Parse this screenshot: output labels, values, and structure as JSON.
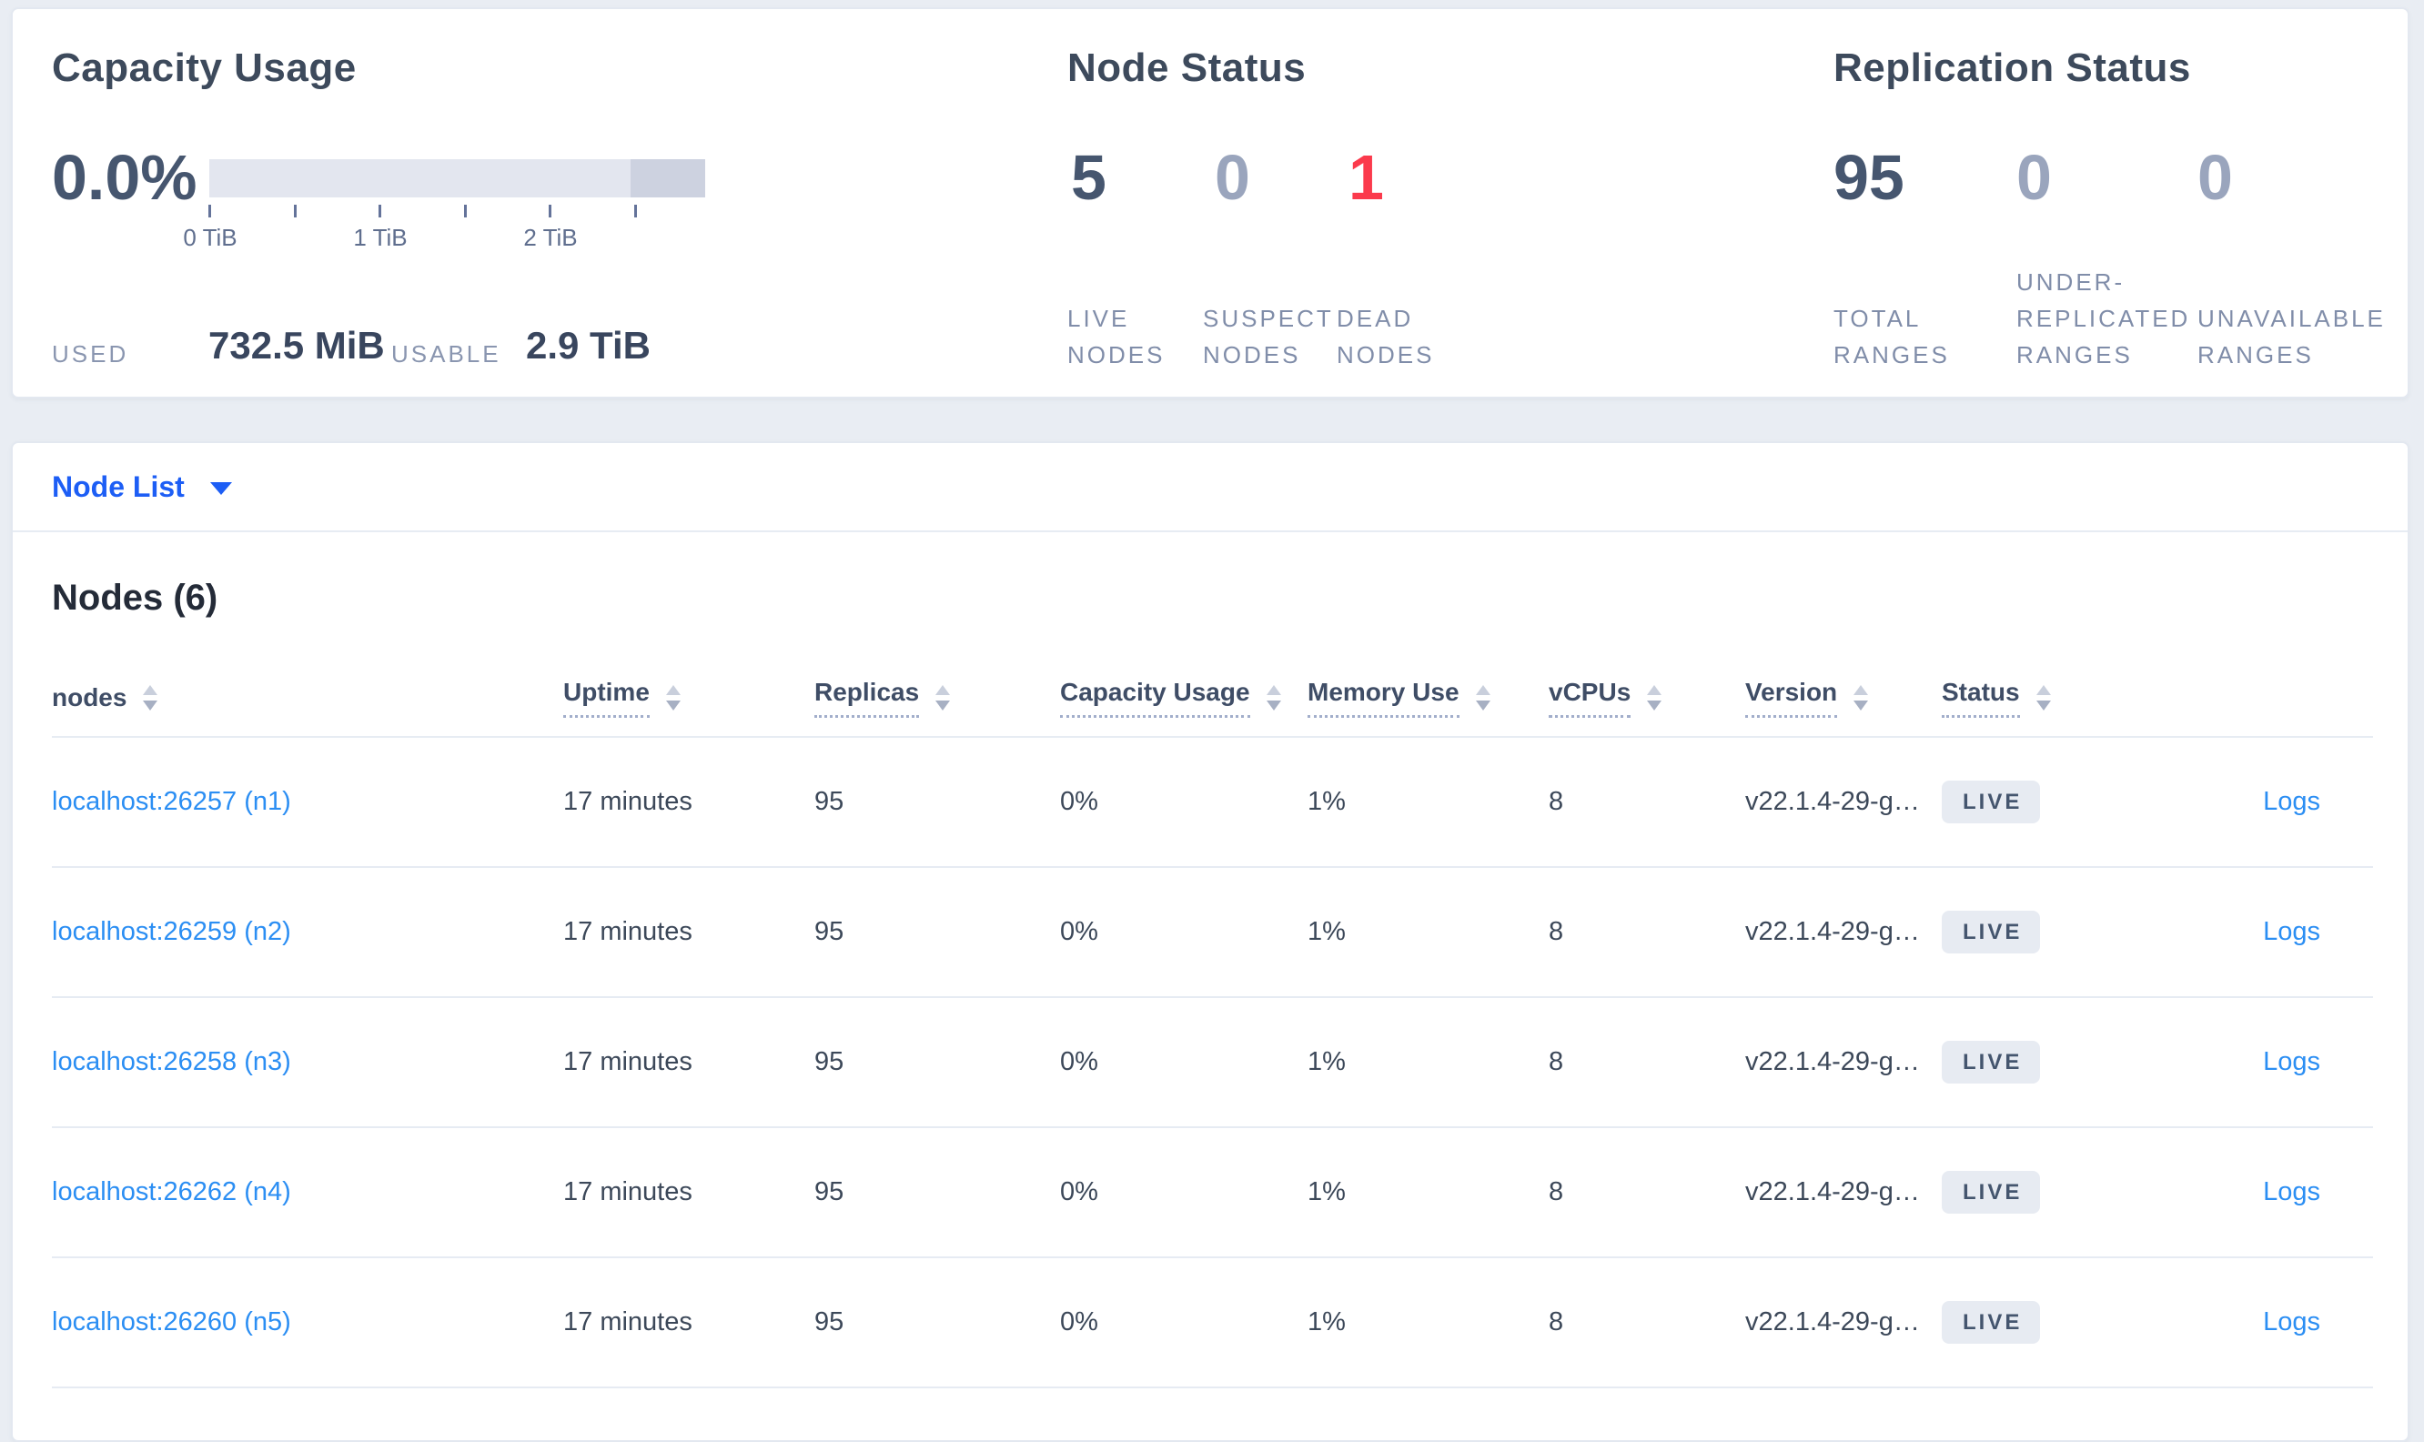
{
  "overview": {
    "capacity": {
      "title": "Capacity Usage",
      "percent": "0.0%",
      "tick_labels": [
        "0 TiB",
        "1 TiB",
        "2 TiB"
      ],
      "used_label": "USED",
      "used_value": "732.5 MiB",
      "usable_label": "USABLE",
      "usable_value": "2.9 TiB"
    },
    "node_status": {
      "title": "Node Status",
      "stats": [
        {
          "value": "5",
          "label": "LIVE NODES"
        },
        {
          "value": "0",
          "label": "SUSPECT NODES"
        },
        {
          "value": "1",
          "label": "DEAD NODES"
        }
      ]
    },
    "replication": {
      "title": "Replication Status",
      "stats": [
        {
          "value": "95",
          "label": "TOTAL RANGES"
        },
        {
          "value": "0",
          "label": "UNDER-REPLICATED RANGES"
        },
        {
          "value": "0",
          "label": "UNAVAILABLE RANGES"
        }
      ]
    }
  },
  "node_list": {
    "dropdown_label": "Node List",
    "heading": "Nodes (6)",
    "columns": {
      "nodes": "nodes",
      "uptime": "Uptime",
      "replicas": "Replicas",
      "capacity": "Capacity Usage",
      "memory": "Memory Use",
      "vcpus": "vCPUs",
      "version": "Version",
      "status": "Status"
    },
    "rows": [
      {
        "node": "localhost:26257 (n1)",
        "uptime": "17 minutes",
        "replicas": "95",
        "capacity": "0%",
        "memory": "1%",
        "vcpus": "8",
        "version": "v22.1.4-29-g…",
        "status": "LIVE",
        "logs": "Logs"
      },
      {
        "node": "localhost:26259 (n2)",
        "uptime": "17 minutes",
        "replicas": "95",
        "capacity": "0%",
        "memory": "1%",
        "vcpus": "8",
        "version": "v22.1.4-29-g…",
        "status": "LIVE",
        "logs": "Logs"
      },
      {
        "node": "localhost:26258 (n3)",
        "uptime": "17 minutes",
        "replicas": "95",
        "capacity": "0%",
        "memory": "1%",
        "vcpus": "8",
        "version": "v22.1.4-29-g…",
        "status": "LIVE",
        "logs": "Logs"
      },
      {
        "node": "localhost:26262 (n4)",
        "uptime": "17 minutes",
        "replicas": "95",
        "capacity": "0%",
        "memory": "1%",
        "vcpus": "8",
        "version": "v22.1.4-29-g…",
        "status": "LIVE",
        "logs": "Logs"
      },
      {
        "node": "localhost:26260 (n5)",
        "uptime": "17 minutes",
        "replicas": "95",
        "capacity": "0%",
        "memory": "1%",
        "vcpus": "8",
        "version": "v22.1.4-29-g…",
        "status": "LIVE",
        "logs": "Logs"
      }
    ]
  },
  "colors": {
    "accent_blue": "#1d5ef5",
    "link_blue": "#2b8ef3",
    "dead_red": "#fb3a4c",
    "muted_number": "#9aa5bd",
    "dark_number": "#46566f"
  }
}
